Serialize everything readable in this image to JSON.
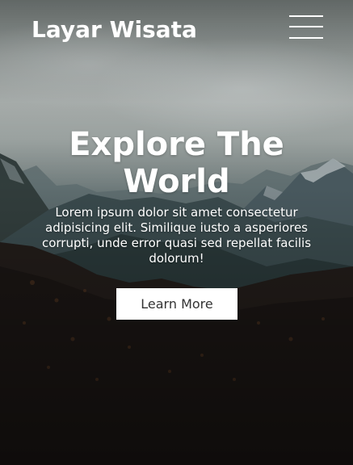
{
  "navbar": {
    "brand": "Layar Wisata",
    "menu_icon": "hamburger-menu-icon"
  },
  "hero": {
    "title": "Explore The World",
    "description": "Lorem ipsum dolor sit amet consectetur adipisicing elit. Similique iusto a asperiores corrupti, unde error quasi sed repellat facilis dolorum!",
    "cta_label": "Learn More",
    "background": "mountain-forest-landscape"
  },
  "colors": {
    "text": "#ffffff",
    "button_bg": "#ffffff",
    "button_text": "#333333"
  }
}
